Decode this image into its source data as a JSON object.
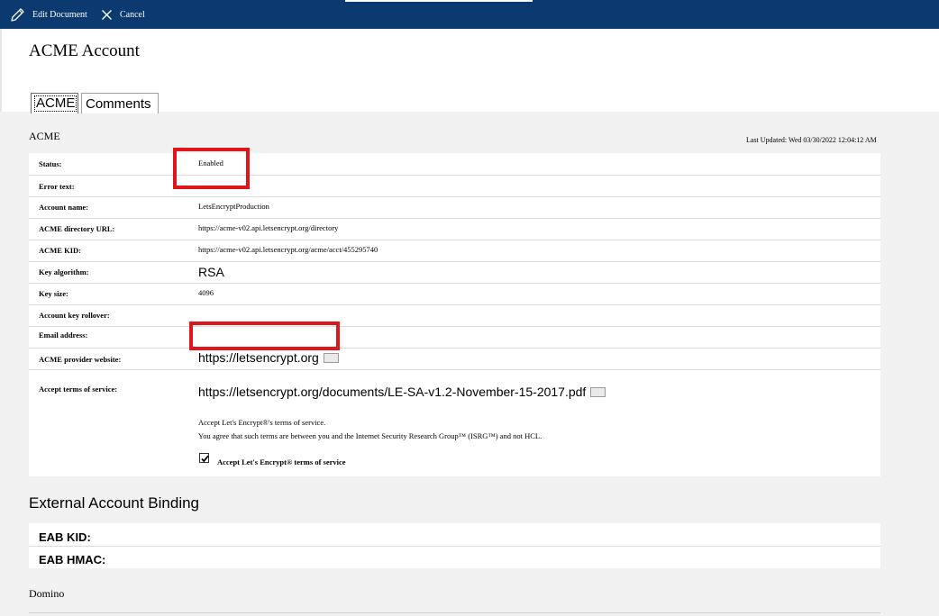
{
  "toolbar": {
    "edit_label": "Edit Document",
    "cancel_label": "Cancel"
  },
  "page_title": "ACME Account",
  "tabs": [
    {
      "label": "ACME"
    },
    {
      "label": "Comments"
    }
  ],
  "section": {
    "label": "ACME",
    "last_updated": "Last Updated: Wed 03/30/2022 12:04:12 AM"
  },
  "fields": {
    "status": {
      "label": "Status:",
      "value": "Enabled"
    },
    "error_text": {
      "label": "Error text:",
      "value": ""
    },
    "account_name": {
      "label": "Account name:",
      "value": "LetsEncryptProduction"
    },
    "directory_url": {
      "label": "ACME directory URL:",
      "value": "https://acme-v02.api.letsencrypt.org/directory"
    },
    "kid": {
      "label": "ACME KID:",
      "value": "https://acme-v02.api.letsencrypt.org/acme/acct/455295740"
    },
    "key_algorithm": {
      "label": "Key algorithm:",
      "value": "RSA"
    },
    "key_size": {
      "label": "Key size:",
      "value": "4096"
    },
    "key_rollover": {
      "label": "Account key rollover:",
      "value": ""
    },
    "email": {
      "label": "Email address:",
      "value": ""
    },
    "provider_website": {
      "label": "ACME provider website:",
      "value": "https://letsencrypt.org"
    },
    "terms": {
      "label": "Accept terms of service:",
      "value": "https://letsencrypt.org/documents/LE-SA-v1.2-November-15-2017.pdf",
      "note_1": "Accept Let's Encrypt®'s terms of service.",
      "note_2": "You agree that such terms are between you and the Internet Security Research Group™ (ISRG™) and not HCL.",
      "checkbox_label": "Accept Let's Encrypt® terms of service",
      "checked": true
    }
  },
  "eab": {
    "title": "External Account Binding",
    "kid_label": "EAB KID:",
    "hmac_label": "EAB HMAC:"
  },
  "footer": {
    "label": "Domino"
  },
  "colors": {
    "toolbar": "#0b3a70",
    "highlight": "#e0161c",
    "background": "#f1f1f1"
  }
}
